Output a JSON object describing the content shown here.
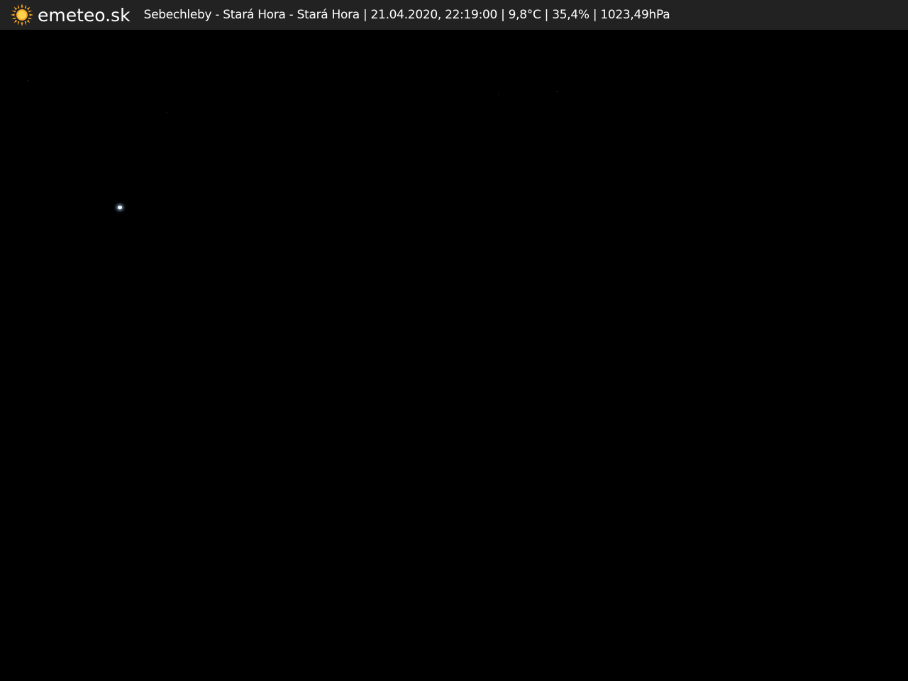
{
  "overlay": {
    "brand": "emeteo.sk",
    "caption": "Sebechleby - Stará Hora - Stará Hora | 21.04.2020, 22:19:00 | 9,8°C | 35,4% | 1023,49hPa"
  },
  "colors": {
    "bar_background": "#222222",
    "sun_icon": "#f5a623",
    "text": "#ffffff",
    "sky": "#000000"
  },
  "icons": {
    "logo": "sun-icon"
  }
}
